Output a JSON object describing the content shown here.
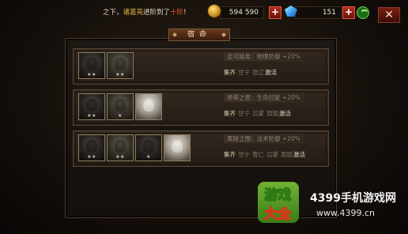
{
  "topbar": {
    "notice": {
      "prefix": "之下，",
      "hero": "诸葛亮",
      "mid": "进阶到了",
      "rank": "十阶",
      "suffix": "!"
    },
    "gold": "594 590",
    "gems": "151",
    "plus_label": "+",
    "close_label": "✕"
  },
  "panel": {
    "title": "宿命",
    "rows": [
      {
        "effect": "足可敌矣：物理防御 +20%",
        "collect_label": "集齐",
        "names": [
          "甘宁",
          "张辽"
        ],
        "state": "激活",
        "stars": [
          "★★",
          "★★"
        ]
      },
      {
        "effect": "举荐之恩：生命回复 +20%",
        "collect_label": "集齐",
        "names": [
          "甘宁",
          "吕蒙",
          "周瑜"
        ],
        "state": "激活",
        "stars": [
          "★★",
          "★",
          ""
        ]
      },
      {
        "effect": "夷陵之围：法术防御 +20%",
        "collect_label": "集齐",
        "names": [
          "甘宁",
          "曹仁",
          "吕蒙",
          "周瑜"
        ],
        "state": "激活",
        "stars": [
          "★★",
          "★★",
          "★",
          ""
        ]
      }
    ]
  },
  "watermark": {
    "logo_line1": "游戏",
    "logo_line2": "大全",
    "site_name": "4399手机游戏网",
    "url": "www.4399.cn"
  },
  "colors": {
    "accent_gold": "#e7b83c",
    "accent_red": "#e65a2a",
    "panel_border": "#5a4630"
  }
}
